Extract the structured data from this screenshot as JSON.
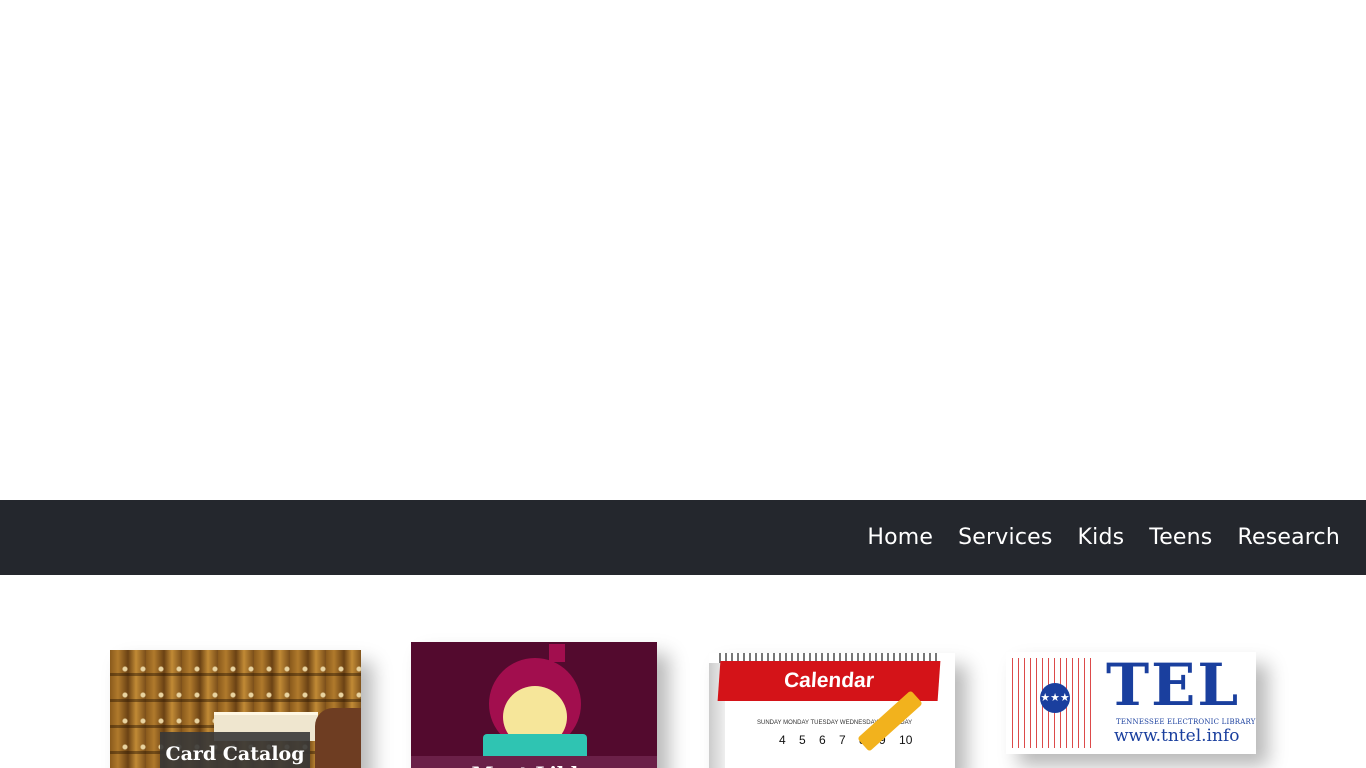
{
  "nav": {
    "items": [
      {
        "label": "Home",
        "active": true
      },
      {
        "label": "Services"
      },
      {
        "label": "Kids"
      },
      {
        "label": "Teens"
      },
      {
        "label": "Research"
      }
    ]
  },
  "tiles": {
    "card_catalog": {
      "label": "Card Catalog"
    },
    "libby": {
      "label": "Meet Libby"
    },
    "calendar": {
      "title": "Calendar",
      "weekdays": "SUNDAY  MONDAY  TUESDAY  WEDNESDAY  THURSDAY",
      "numbers": "4 5 6 7 8 9 10"
    },
    "tel": {
      "title": "TEL",
      "subtitle": "TENNESSEE ELECTRONIC LIBRARY",
      "url": "www.tntel.info"
    }
  },
  "colors": {
    "navbar_bg": "#24272d",
    "libby_bg": "#530a2e",
    "calendar_red": "#d41318",
    "tel_blue": "#1a3f9e"
  }
}
